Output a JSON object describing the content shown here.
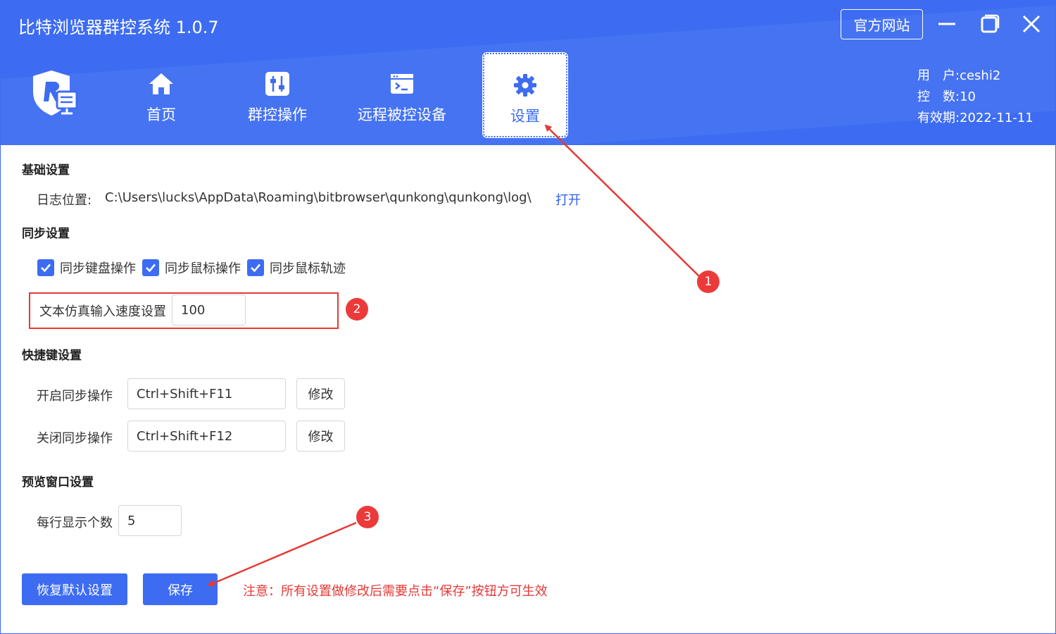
{
  "app": {
    "title": "比特浏览器群控系统 1.0.7",
    "official_site": "官方网站"
  },
  "nav": {
    "home": "首页",
    "group_control": "群控操作",
    "remote_devices": "远程被控设备",
    "settings": "设置"
  },
  "user": {
    "user_label": "用　户:",
    "user_value": "ceshi2",
    "count_label": "控　数:",
    "count_value": "10",
    "expiry_label": "有效期:",
    "expiry_value": "2022-11-11"
  },
  "basic": {
    "title": "基础设置",
    "log_label": "日志位置:",
    "log_path": "C:\\Users\\lucks\\AppData\\Roaming\\bitbrowser\\qunkong\\qunkong\\log\\",
    "open": "打开"
  },
  "sync": {
    "title": "同步设置",
    "keyboard": "同步键盘操作",
    "mouse": "同步鼠标操作",
    "mouse_track": "同步鼠标轨迹",
    "speed_label": "文本仿真输入速度设置",
    "speed_value": "100"
  },
  "hotkey": {
    "title": "快捷键设置",
    "start_label": "开启同步操作",
    "start_value": "Ctrl+Shift+F11",
    "stop_label": "关闭同步操作",
    "stop_value": "Ctrl+Shift+F12",
    "modify": "修改"
  },
  "preview": {
    "title": "预览窗口设置",
    "per_row_label": "每行显示个数",
    "per_row_value": "5"
  },
  "actions": {
    "restore": "恢复默认设置",
    "save": "保存",
    "notice": "注意：所有设置做修改后需要点击“保存”按钮方可生效"
  },
  "annotations": {
    "badge1": "1",
    "badge2": "2",
    "badge3": "3"
  },
  "colors": {
    "primary": "#3d6cf2",
    "annotation_red": "#e53935"
  },
  "icons": {
    "home": "home-icon",
    "group": "sliders-icon",
    "remote": "terminal-icon",
    "settings": "gear-icon"
  }
}
